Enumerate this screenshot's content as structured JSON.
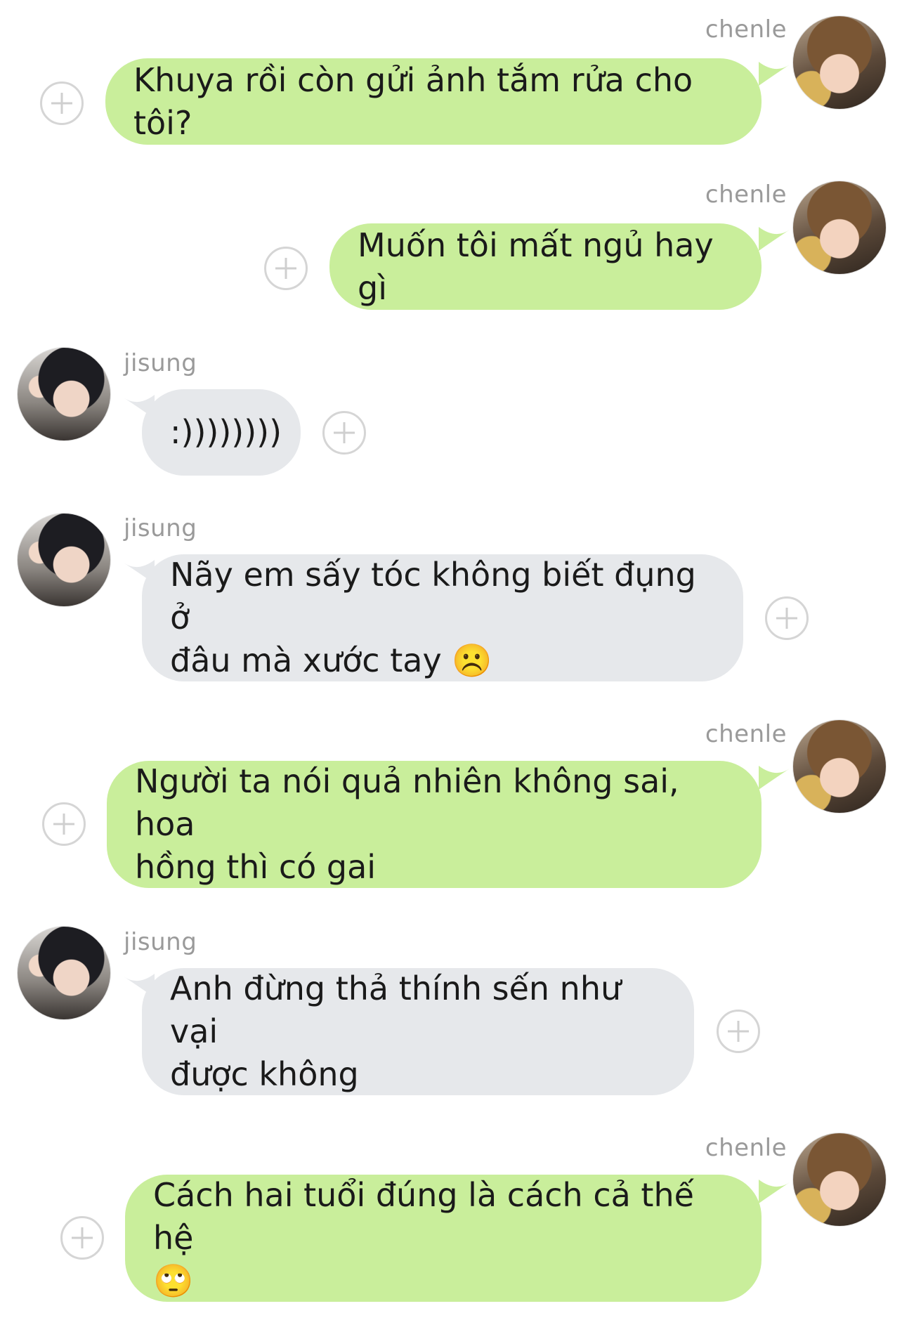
{
  "messages": [
    {
      "sender": "chenle",
      "side": "right",
      "text": "Khuya rồi còn gửi ảnh tắm rửa cho tôi?"
    },
    {
      "sender": "chenle",
      "side": "right",
      "text": "Muốn tôi mất ngủ hay gì"
    },
    {
      "sender": "jisung",
      "side": "left",
      "text": ":))))))))"
    },
    {
      "sender": "jisung",
      "side": "left",
      "text": "Nãy em sấy tóc không biết đụng ở\nđâu mà xước tay ☹️"
    },
    {
      "sender": "chenle",
      "side": "right",
      "text": "Người ta nói quả nhiên không sai, hoa\nhồng thì có gai"
    },
    {
      "sender": "jisung",
      "side": "left",
      "text": "Anh đừng thả thính sến như vại\nđược không"
    },
    {
      "sender": "chenle",
      "side": "right",
      "text": "Cách hai tuổi đúng là cách cả thế hệ\n🙄"
    }
  ],
  "colors": {
    "sent_bubble": "#c9ee9b",
    "received_bubble": "#e6e8eb",
    "sender_name": "#9a9a9a"
  },
  "icons": {
    "react": "plus-circle-icon"
  }
}
